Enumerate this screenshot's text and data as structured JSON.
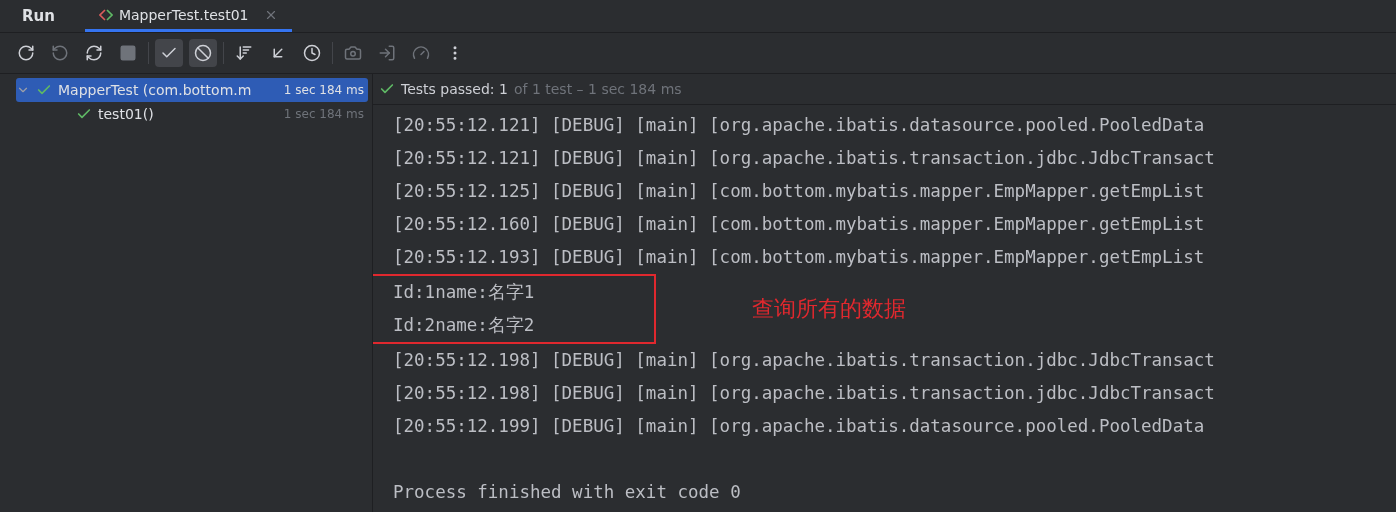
{
  "tool_window": {
    "title": "Run"
  },
  "tabs": [
    {
      "label": "MapperTest.test01",
      "selected": true
    }
  ],
  "toolbar": [
    {
      "disabled": false,
      "selected": false
    },
    {
      "disabled": true,
      "selected": false
    },
    {
      "disabled": false,
      "selected": false
    },
    {
      "disabled": true,
      "selected": false
    },
    {
      "disabled": false,
      "selected": true
    },
    {
      "disabled": false,
      "selected": true
    },
    {
      "disabled": false,
      "selected": false
    },
    {
      "disabled": false,
      "selected": false
    },
    {
      "disabled": false,
      "selected": false
    },
    {
      "disabled": true,
      "selected": false
    },
    {
      "disabled": true,
      "selected": false
    },
    {
      "disabled": true,
      "selected": false
    },
    {
      "disabled": false,
      "selected": false
    }
  ],
  "test_tree": [
    {
      "name": "MapperTest (com.bottom.m",
      "time": "1 sec 184 ms",
      "passed": true,
      "selected": true,
      "expanded": true,
      "children": [
        {
          "name": "test01()",
          "time": "1 sec 184 ms",
          "passed": true,
          "selected": false
        }
      ]
    }
  ],
  "status": {
    "passed": true,
    "summary": "Tests passed: 1",
    "detail": "of 1 test – 1 sec 184 ms"
  },
  "console": [
    {
      "kind": "log",
      "text": "[20:55:12.121] [DEBUG] [main] [org.apache.ibatis.datasource.pooled.PooledData"
    },
    {
      "kind": "log",
      "text": "[20:55:12.121] [DEBUG] [main] [org.apache.ibatis.transaction.jdbc.JdbcTransact"
    },
    {
      "kind": "log",
      "text": "[20:55:12.125] [DEBUG] [main] [com.bottom.mybatis.mapper.EmpMapper.getEmpList"
    },
    {
      "kind": "log",
      "text": "[20:55:12.160] [DEBUG] [main] [com.bottom.mybatis.mapper.EmpMapper.getEmpList"
    },
    {
      "kind": "log",
      "text": "[20:55:12.193] [DEBUG] [main] [com.bottom.mybatis.mapper.EmpMapper.getEmpList"
    },
    {
      "kind": "highlight",
      "lines": [
        "Id:1name:名字1",
        "Id:2name:名字2"
      ],
      "note": "查询所有的数据"
    },
    {
      "kind": "log",
      "text": "[20:55:12.198] [DEBUG] [main] [org.apache.ibatis.transaction.jdbc.JdbcTransact"
    },
    {
      "kind": "log",
      "text": "[20:55:12.198] [DEBUG] [main] [org.apache.ibatis.transaction.jdbc.JdbcTransact"
    },
    {
      "kind": "log",
      "text": "[20:55:12.199] [DEBUG] [main] [org.apache.ibatis.datasource.pooled.PooledData"
    },
    {
      "kind": "blank"
    },
    {
      "kind": "log",
      "text": "Process finished with exit code 0"
    }
  ]
}
